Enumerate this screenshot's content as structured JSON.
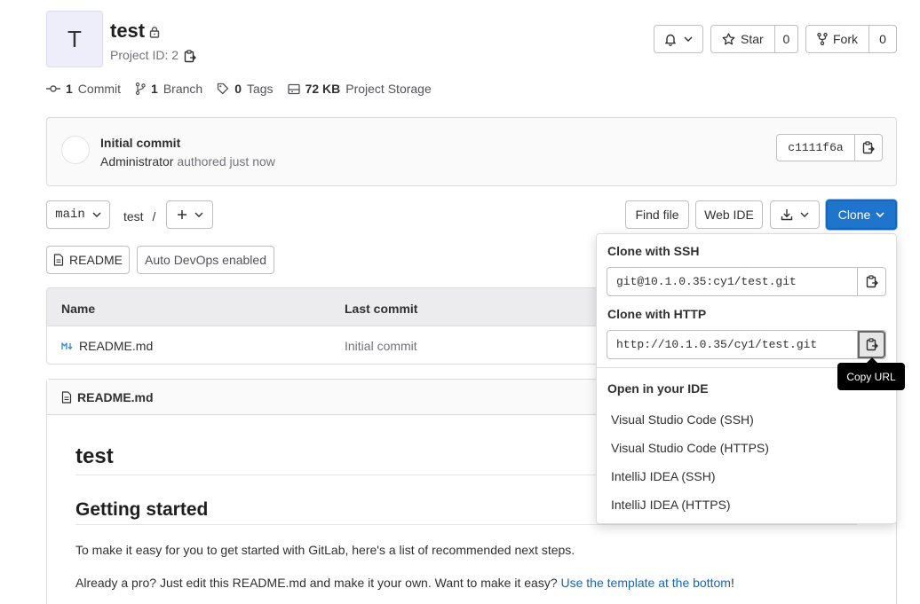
{
  "project": {
    "avatar_letter": "T",
    "name": "test",
    "id_text": "Project ID: 2"
  },
  "actions": {
    "star_label": "Star",
    "star_count": "0",
    "fork_label": "Fork",
    "fork_count": "0"
  },
  "stats": {
    "commits_count": "1",
    "commits_label": "Commit",
    "branches_count": "1",
    "branches_label": "Branch",
    "tags_count": "0",
    "tags_label": "Tags",
    "storage_size": "72 KB",
    "storage_label": "Project Storage"
  },
  "last_commit": {
    "title": "Initial commit",
    "author": "Administrator",
    "meta": "authored just now",
    "sha": "c1111f6a"
  },
  "toolbar": {
    "branch": "main",
    "path": "test",
    "path_sep": "/",
    "find_file": "Find file",
    "web_ide": "Web IDE",
    "clone": "Clone",
    "readme": "README",
    "auto_devops": "Auto DevOps enabled"
  },
  "files": {
    "columns": [
      "Name",
      "Last commit"
    ],
    "rows": [
      {
        "name": "README.md",
        "last_commit": "Initial commit"
      }
    ]
  },
  "readme": {
    "filename": "README.md",
    "h1": "test",
    "h2": "Getting started",
    "p1": "To make it easy for you to get started with GitLab, here's a list of recommended next steps.",
    "p2_text": "Already a pro? Just edit this README.md and make it your own. Want to make it easy? ",
    "p2_link": "Use the template at the bottom",
    "p2_end": "!"
  },
  "clone_dropdown": {
    "ssh_label": "Clone with SSH",
    "ssh_url": "git@10.1.0.35:cy1/test.git",
    "http_label": "Clone with HTTP",
    "http_url": "http://10.1.0.35/cy1/test.git",
    "ide_label": "Open in your IDE",
    "ide_items": [
      "Visual Studio Code (SSH)",
      "Visual Studio Code (HTTPS)",
      "IntelliJ IDEA (SSH)",
      "IntelliJ IDEA (HTTPS)"
    ]
  },
  "tooltip": "Copy URL",
  "colors": {
    "primary": "#1f75cb",
    "link": "#1068bf",
    "text": "#303030",
    "muted": "#737278",
    "border": "#dbdbdb"
  }
}
